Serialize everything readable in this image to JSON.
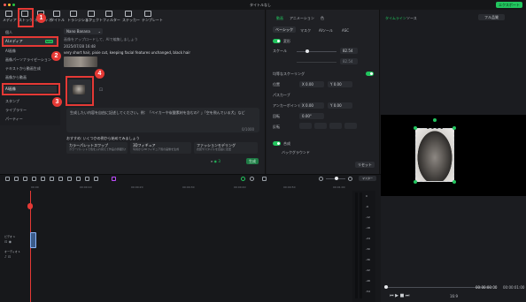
{
  "window": {
    "title": "タイトルなし",
    "export_label": "エクスポート"
  },
  "toolbar": [
    {
      "label": "メディア",
      "icon": "media-icon"
    },
    {
      "label": "ストック",
      "icon": "stock-icon"
    },
    {
      "label": "オーディオ",
      "icon": "audio-icon"
    },
    {
      "label": "タイトル",
      "icon": "title-icon"
    },
    {
      "label": "トランジション",
      "icon": "transition-icon"
    },
    {
      "label": "エフェクト",
      "icon": "effect-icon"
    },
    {
      "label": "フィルター",
      "icon": "filter-icon"
    },
    {
      "label": "ステッカー",
      "icon": "sticker-icon"
    },
    {
      "label": "テンプレート",
      "icon": "template-icon"
    }
  ],
  "sidebar": {
    "items": [
      {
        "label": "個人"
      },
      {
        "label": "AIメディア"
      },
      {
        "label": "AI画像"
      },
      {
        "label": "画像パーソナライゼーション"
      },
      {
        "label": "テキストから動画生成"
      },
      {
        "label": "画像から動画"
      },
      {
        "label": "AI画像"
      },
      {
        "label": "スタンプ"
      },
      {
        "label": "ライブラリー"
      },
      {
        "label": "パーティー"
      }
    ],
    "badge": "NEW"
  },
  "ai_panel": {
    "model": "Nano Banana",
    "note": "画像をアップロードして、AIで編集しましょう",
    "timestamp": "2025/07/28 16:48",
    "prompt": "very short hair, pixie cut, keeping facial features unchanged, black hair",
    "input_text": "生成したい内容を自由に記述してください。例：「ベイカーや炭酸素材を含むの？」「空を飛んでいる犬」など",
    "char_count": "0/1000",
    "suggest_title": "おすすめ: いくつかの例から始めてみましょう",
    "suggestions": [
      {
        "title": "カラーパレットスワップ",
        "desc": "カラーパレットで色を入れ替えて作品の雰囲気を変更"
      },
      {
        "title": "3Dフィギュア",
        "desc": "写真から3Dフィギュア風の画像を生成"
      },
      {
        "title": "ファッションモデリング",
        "desc": "衣装やスタイルを自由に変更"
      }
    ],
    "generate_label": "生成",
    "credits": "3"
  },
  "inspector": {
    "tabs": [
      "動画",
      "アニメーション",
      "色"
    ],
    "sub_tabs": [
      "ベーシック",
      "マスク",
      "AIツール",
      "ASC"
    ],
    "transform_label": "変形",
    "scale_label": "スケール",
    "scale_value": "82.54",
    "scale_sub_value": "82.54",
    "uniform_label": "均等なスケーリング",
    "position_label": "位置",
    "pos_x": "0.00",
    "pos_y": "0.00",
    "path_label": "パスカーブ",
    "anchor_label": "アンカーポイント",
    "anchor_x": "0.00",
    "anchor_y": "0.00",
    "rotate_label": "回転",
    "rotate_value": "0.00°",
    "flip_label": "反転",
    "composite_label": "合成",
    "background_label": "バックグラウンド",
    "reset_label": "リセット"
  },
  "preview": {
    "tabs": [
      "タイムライン",
      "ソース"
    ],
    "quality": "フル品質",
    "time_current": "00:00:00:00",
    "time_total": "00:00:01:00",
    "ratio": "16:9"
  },
  "timeline": {
    "ruler": [
      "00:00",
      "00:00:10",
      "00:00:20",
      "00:00:30",
      "00:00:40",
      "00:00:50",
      "00:01:00",
      "00:01:10"
    ],
    "track1_label": "ビデオ 1",
    "track2_label": "オーディオ 1",
    "master_label": "マスター",
    "meter_labels": [
      "0",
      "-6",
      "-12",
      "-18",
      "-24",
      "-30",
      "-36",
      "-42",
      "-48",
      "-54"
    ]
  },
  "markers": [
    "1",
    "2",
    "3",
    "4"
  ],
  "colors": {
    "accent": "#22c55e",
    "highlight": "#e53935",
    "panel": "#1f2024",
    "stage": "#000000"
  }
}
